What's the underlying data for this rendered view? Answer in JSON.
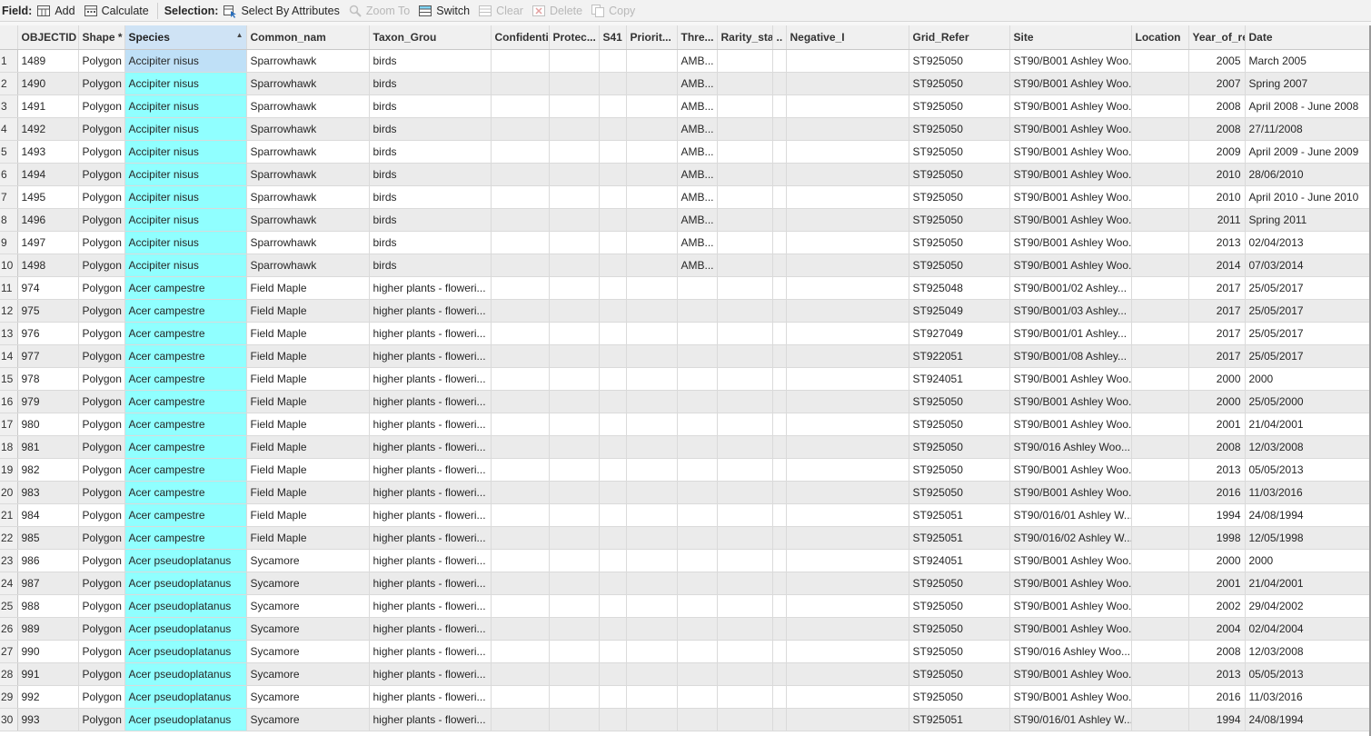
{
  "toolbar": {
    "field_label": "Field:",
    "add_label": "Add",
    "calculate_label": "Calculate",
    "selection_label": "Selection:",
    "select_by_attributes_label": "Select By Attributes",
    "zoom_to_label": "Zoom To",
    "switch_label": "Switch",
    "clear_label": "Clear",
    "delete_label": "Delete",
    "copy_label": "Copy"
  },
  "table": {
    "sorted_column": "Species",
    "columns": [
      "OBJECTID *",
      "Shape *",
      "Species",
      "Common_nam",
      "Taxon_Grou",
      "Confidenti",
      "Protec...",
      "S41",
      "Priorit...",
      "Thre...",
      "Rarity_sta",
      "..",
      "Negative_I",
      "Grid_Refer",
      "Site",
      "Location",
      "Year_of_re",
      "Date"
    ],
    "rows": [
      [
        "1",
        "1489",
        "Polygon",
        "Accipiter nisus",
        "Sparrowhawk",
        "birds",
        "",
        "",
        "",
        "",
        "AMB...",
        "",
        "",
        "",
        "ST925050",
        "ST90/B001 Ashley Woo...",
        "",
        "2005",
        "March 2005"
      ],
      [
        "2",
        "1490",
        "Polygon",
        "Accipiter nisus",
        "Sparrowhawk",
        "birds",
        "",
        "",
        "",
        "",
        "AMB...",
        "",
        "",
        "",
        "ST925050",
        "ST90/B001 Ashley Woo...",
        "",
        "2007",
        "Spring 2007"
      ],
      [
        "3",
        "1491",
        "Polygon",
        "Accipiter nisus",
        "Sparrowhawk",
        "birds",
        "",
        "",
        "",
        "",
        "AMB...",
        "",
        "",
        "",
        "ST925050",
        "ST90/B001 Ashley Woo...",
        "",
        "2008",
        "April 2008 - June 2008"
      ],
      [
        "4",
        "1492",
        "Polygon",
        "Accipiter nisus",
        "Sparrowhawk",
        "birds",
        "",
        "",
        "",
        "",
        "AMB...",
        "",
        "",
        "",
        "ST925050",
        "ST90/B001 Ashley Woo...",
        "",
        "2008",
        "27/11/2008"
      ],
      [
        "5",
        "1493",
        "Polygon",
        "Accipiter nisus",
        "Sparrowhawk",
        "birds",
        "",
        "",
        "",
        "",
        "AMB...",
        "",
        "",
        "",
        "ST925050",
        "ST90/B001 Ashley Woo...",
        "",
        "2009",
        "April 2009 - June 2009"
      ],
      [
        "6",
        "1494",
        "Polygon",
        "Accipiter nisus",
        "Sparrowhawk",
        "birds",
        "",
        "",
        "",
        "",
        "AMB...",
        "",
        "",
        "",
        "ST925050",
        "ST90/B001 Ashley Woo...",
        "",
        "2010",
        "28/06/2010"
      ],
      [
        "7",
        "1495",
        "Polygon",
        "Accipiter nisus",
        "Sparrowhawk",
        "birds",
        "",
        "",
        "",
        "",
        "AMB...",
        "",
        "",
        "",
        "ST925050",
        "ST90/B001 Ashley Woo...",
        "",
        "2010",
        "April 2010 - June 2010"
      ],
      [
        "8",
        "1496",
        "Polygon",
        "Accipiter nisus",
        "Sparrowhawk",
        "birds",
        "",
        "",
        "",
        "",
        "AMB...",
        "",
        "",
        "",
        "ST925050",
        "ST90/B001 Ashley Woo...",
        "",
        "2011",
        "Spring 2011"
      ],
      [
        "9",
        "1497",
        "Polygon",
        "Accipiter nisus",
        "Sparrowhawk",
        "birds",
        "",
        "",
        "",
        "",
        "AMB...",
        "",
        "",
        "",
        "ST925050",
        "ST90/B001 Ashley Woo...",
        "",
        "2013",
        "02/04/2013"
      ],
      [
        "10",
        "1498",
        "Polygon",
        "Accipiter nisus",
        "Sparrowhawk",
        "birds",
        "",
        "",
        "",
        "",
        "AMB...",
        "",
        "",
        "",
        "ST925050",
        "ST90/B001 Ashley Woo...",
        "",
        "2014",
        "07/03/2014"
      ],
      [
        "11",
        "974",
        "Polygon",
        "Acer campestre",
        "Field Maple",
        "higher plants - floweri...",
        "",
        "",
        "",
        "",
        "",
        "",
        "",
        "",
        "ST925048",
        "ST90/B001/02 Ashley...",
        "",
        "2017",
        "25/05/2017"
      ],
      [
        "12",
        "975",
        "Polygon",
        "Acer campestre",
        "Field Maple",
        "higher plants - floweri...",
        "",
        "",
        "",
        "",
        "",
        "",
        "",
        "",
        "ST925049",
        "ST90/B001/03 Ashley...",
        "",
        "2017",
        "25/05/2017"
      ],
      [
        "13",
        "976",
        "Polygon",
        "Acer campestre",
        "Field Maple",
        "higher plants - floweri...",
        "",
        "",
        "",
        "",
        "",
        "",
        "",
        "",
        "ST927049",
        "ST90/B001/01 Ashley...",
        "",
        "2017",
        "25/05/2017"
      ],
      [
        "14",
        "977",
        "Polygon",
        "Acer campestre",
        "Field Maple",
        "higher plants - floweri...",
        "",
        "",
        "",
        "",
        "",
        "",
        "",
        "",
        "ST922051",
        "ST90/B001/08 Ashley...",
        "",
        "2017",
        "25/05/2017"
      ],
      [
        "15",
        "978",
        "Polygon",
        "Acer campestre",
        "Field Maple",
        "higher plants - floweri...",
        "",
        "",
        "",
        "",
        "",
        "",
        "",
        "",
        "ST924051",
        "ST90/B001 Ashley Woo...",
        "",
        "2000",
        "2000"
      ],
      [
        "16",
        "979",
        "Polygon",
        "Acer campestre",
        "Field Maple",
        "higher plants - floweri...",
        "",
        "",
        "",
        "",
        "",
        "",
        "",
        "",
        "ST925050",
        "ST90/B001 Ashley Woo...",
        "",
        "2000",
        "25/05/2000"
      ],
      [
        "17",
        "980",
        "Polygon",
        "Acer campestre",
        "Field Maple",
        "higher plants - floweri...",
        "",
        "",
        "",
        "",
        "",
        "",
        "",
        "",
        "ST925050",
        "ST90/B001 Ashley Woo...",
        "",
        "2001",
        "21/04/2001"
      ],
      [
        "18",
        "981",
        "Polygon",
        "Acer campestre",
        "Field Maple",
        "higher plants - floweri...",
        "",
        "",
        "",
        "",
        "",
        "",
        "",
        "",
        "ST925050",
        "ST90/016 Ashley Woo...",
        "",
        "2008",
        "12/03/2008"
      ],
      [
        "19",
        "982",
        "Polygon",
        "Acer campestre",
        "Field Maple",
        "higher plants - floweri...",
        "",
        "",
        "",
        "",
        "",
        "",
        "",
        "",
        "ST925050",
        "ST90/B001 Ashley Woo...",
        "",
        "2013",
        "05/05/2013"
      ],
      [
        "20",
        "983",
        "Polygon",
        "Acer campestre",
        "Field Maple",
        "higher plants - floweri...",
        "",
        "",
        "",
        "",
        "",
        "",
        "",
        "",
        "ST925050",
        "ST90/B001 Ashley Woo...",
        "",
        "2016",
        "11/03/2016"
      ],
      [
        "21",
        "984",
        "Polygon",
        "Acer campestre",
        "Field Maple",
        "higher plants - floweri...",
        "",
        "",
        "",
        "",
        "",
        "",
        "",
        "",
        "ST925051",
        "ST90/016/01 Ashley W...",
        "",
        "1994",
        "24/08/1994"
      ],
      [
        "22",
        "985",
        "Polygon",
        "Acer campestre",
        "Field Maple",
        "higher plants - floweri...",
        "",
        "",
        "",
        "",
        "",
        "",
        "",
        "",
        "ST925051",
        "ST90/016/02 Ashley W...",
        "",
        "1998",
        "12/05/1998"
      ],
      [
        "23",
        "986",
        "Polygon",
        "Acer pseudoplatanus",
        "Sycamore",
        "higher plants - floweri...",
        "",
        "",
        "",
        "",
        "",
        "",
        "",
        "",
        "ST924051",
        "ST90/B001 Ashley Woo...",
        "",
        "2000",
        "2000"
      ],
      [
        "24",
        "987",
        "Polygon",
        "Acer pseudoplatanus",
        "Sycamore",
        "higher plants - floweri...",
        "",
        "",
        "",
        "",
        "",
        "",
        "",
        "",
        "ST925050",
        "ST90/B001 Ashley Woo...",
        "",
        "2001",
        "21/04/2001"
      ],
      [
        "25",
        "988",
        "Polygon",
        "Acer pseudoplatanus",
        "Sycamore",
        "higher plants - floweri...",
        "",
        "",
        "",
        "",
        "",
        "",
        "",
        "",
        "ST925050",
        "ST90/B001 Ashley Woo...",
        "",
        "2002",
        "29/04/2002"
      ],
      [
        "26",
        "989",
        "Polygon",
        "Acer pseudoplatanus",
        "Sycamore",
        "higher plants - floweri...",
        "",
        "",
        "",
        "",
        "",
        "",
        "",
        "",
        "ST925050",
        "ST90/B001 Ashley Woo...",
        "",
        "2004",
        "02/04/2004"
      ],
      [
        "27",
        "990",
        "Polygon",
        "Acer pseudoplatanus",
        "Sycamore",
        "higher plants - floweri...",
        "",
        "",
        "",
        "",
        "",
        "",
        "",
        "",
        "ST925050",
        "ST90/016 Ashley Woo...",
        "",
        "2008",
        "12/03/2008"
      ],
      [
        "28",
        "991",
        "Polygon",
        "Acer pseudoplatanus",
        "Sycamore",
        "higher plants - floweri...",
        "",
        "",
        "",
        "",
        "",
        "",
        "",
        "",
        "ST925050",
        "ST90/B001 Ashley Woo...",
        "",
        "2013",
        "05/05/2013"
      ],
      [
        "29",
        "992",
        "Polygon",
        "Acer pseudoplatanus",
        "Sycamore",
        "higher plants - floweri...",
        "",
        "",
        "",
        "",
        "",
        "",
        "",
        "",
        "ST925050",
        "ST90/B001 Ashley Woo...",
        "",
        "2016",
        "11/03/2016"
      ],
      [
        "30",
        "993",
        "Polygon",
        "Acer pseudoplatanus",
        "Sycamore",
        "higher plants - floweri...",
        "",
        "",
        "",
        "",
        "",
        "",
        "",
        "",
        "ST925051",
        "ST90/016/01 Ashley W...",
        "",
        "1994",
        "24/08/1994"
      ]
    ]
  }
}
